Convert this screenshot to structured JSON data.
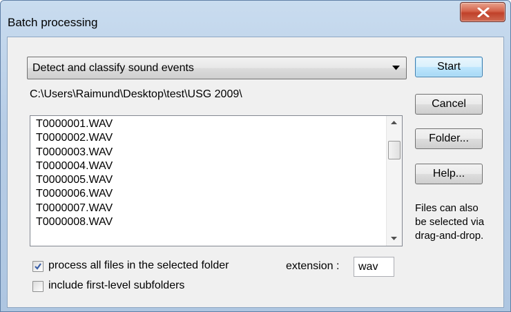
{
  "window": {
    "title": "Batch processing",
    "close_icon": "close-x-icon"
  },
  "mode_select": {
    "selected": "Detect and classify sound events",
    "arrow_icon": "dropdown-arrow-icon"
  },
  "folder_path": "C:\\Users\\Raimund\\Desktop\\test\\USG 2009\\",
  "file_list": {
    "items": [
      "T0000001.WAV",
      "T0000002.WAV",
      "T0000003.WAV",
      "T0000004.WAV",
      "T0000005.WAV",
      "T0000006.WAV",
      "T0000007.WAV",
      "T0000008.WAV"
    ]
  },
  "buttons": {
    "start": "Start",
    "cancel": "Cancel",
    "folder": "Folder...",
    "help": "Help..."
  },
  "hint": [
    "Files can also",
    "be selected via",
    "drag-and-drop."
  ],
  "options": {
    "process_all_label": "process all files in the selected folder",
    "process_all_checked": true,
    "subfolders_label": "include first-level subfolders",
    "subfolders_checked": false
  },
  "extension": {
    "label": "extension :",
    "value": "wav"
  },
  "colors": {
    "default_button_border": "#3c7fb1",
    "close_button": "#c0412a"
  }
}
